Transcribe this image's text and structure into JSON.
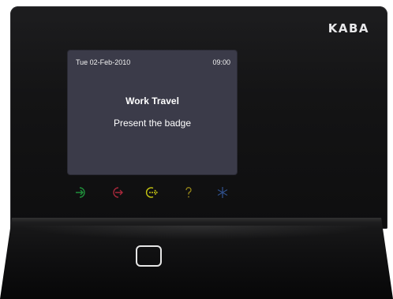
{
  "brand": {
    "logo_text": "KABA"
  },
  "screen": {
    "date": "Tue 02-Feb-2010",
    "time": "09:00",
    "title": "Work Travel",
    "message": "Present the badge",
    "background": "#3b3b49"
  },
  "keys": [
    {
      "icon": "arrow-in-icon",
      "color": "#1f8f3a"
    },
    {
      "icon": "arrow-out-icon",
      "color": "#a8283b"
    },
    {
      "icon": "arrow-right-circle-icon",
      "color": "#c8c812"
    },
    {
      "icon": "question-icon",
      "color": "#9a8a1a"
    },
    {
      "icon": "asterisk-icon",
      "color": "#2f4f88"
    }
  ],
  "reader": {
    "icon": "badge-reader-icon"
  }
}
